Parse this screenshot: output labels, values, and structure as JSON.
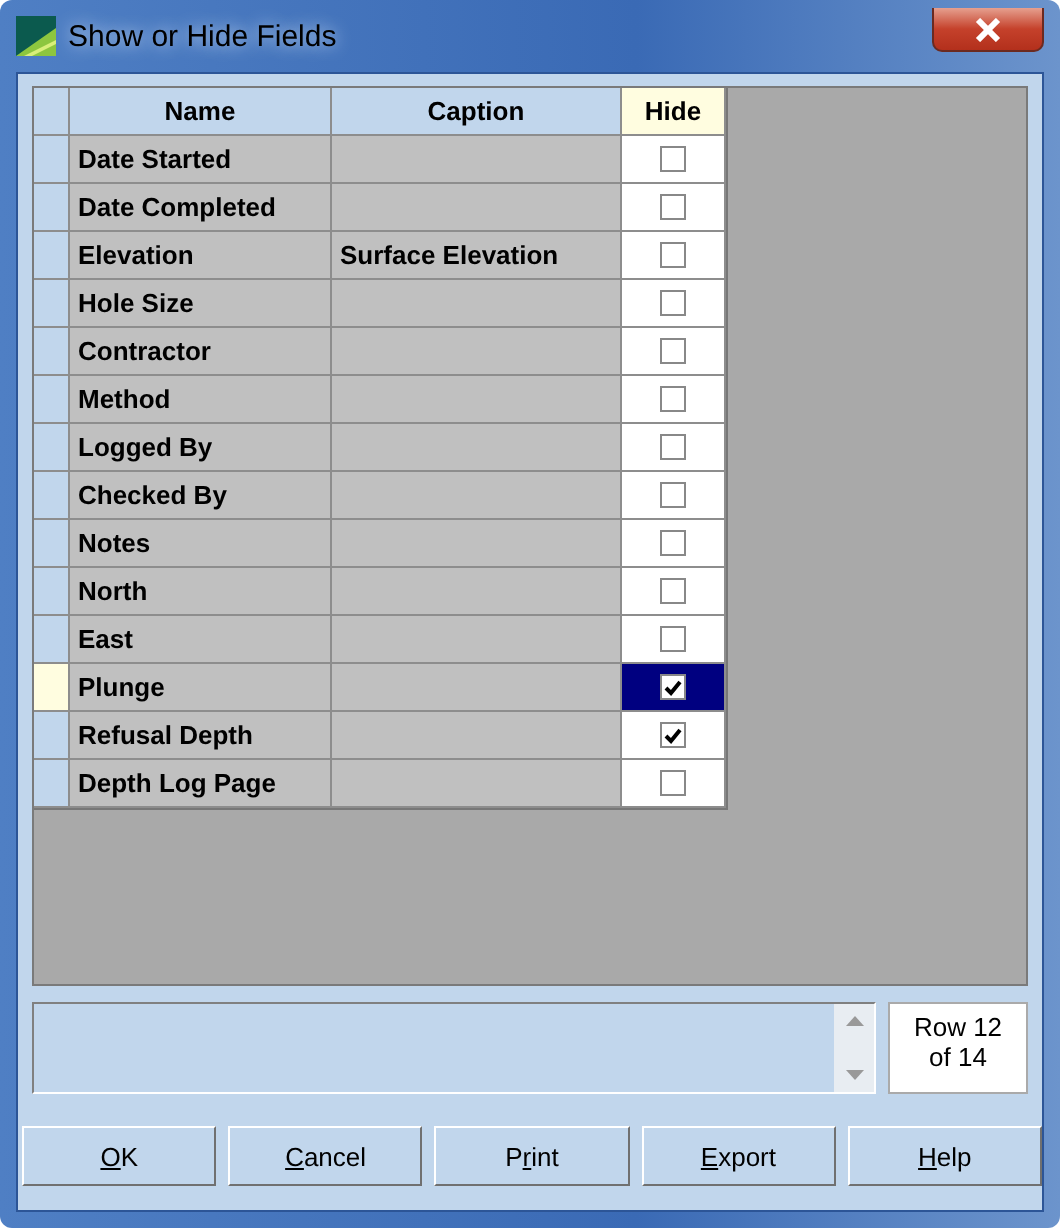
{
  "window": {
    "title": "Show or Hide Fields"
  },
  "table": {
    "columns": [
      {
        "label": "Name",
        "selected": false
      },
      {
        "label": "Caption",
        "selected": false
      },
      {
        "label": "Hide",
        "selected": true
      }
    ],
    "rows": [
      {
        "name": "Date Started",
        "hide": false,
        "selected": false
      },
      {
        "name": "Date Completed",
        "hide": false,
        "selected": false
      },
      {
        "name": "Elevation",
        "caption": "Surface Elevation",
        "hide": false,
        "selected": false
      },
      {
        "name": "Hole Size",
        "hide": false,
        "selected": false
      },
      {
        "name": "Contractor",
        "hide": false,
        "selected": false
      },
      {
        "name": "Method",
        "hide": false,
        "selected": false
      },
      {
        "name": "Logged By",
        "hide": false,
        "selected": false
      },
      {
        "name": "Checked By",
        "hide": false,
        "selected": false
      },
      {
        "name": "Notes",
        "hide": false,
        "selected": false
      },
      {
        "name": "North",
        "hide": false,
        "selected": false
      },
      {
        "name": "East",
        "hide": false,
        "selected": false
      },
      {
        "name": "Plunge",
        "hide": true,
        "selected": true
      },
      {
        "name": "Refusal Depth",
        "hide": true,
        "selected": false
      },
      {
        "name": "Depth Log Page",
        "hide": false,
        "selected": false
      }
    ]
  },
  "row_counter": "Row 12\nof 14",
  "buttons": [
    {
      "key": "O",
      "after": "K"
    },
    {
      "key": "C",
      "after": "ancel"
    },
    {
      "before": "P",
      "key": "r",
      "after": "int"
    },
    {
      "key": "E",
      "after": "xport"
    },
    {
      "key": "H",
      "after": "elp"
    }
  ]
}
